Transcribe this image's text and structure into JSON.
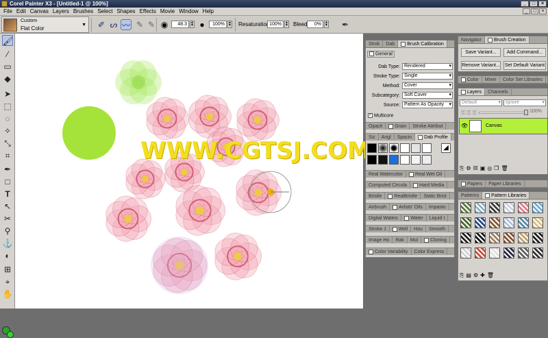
{
  "app": {
    "title": "Corel Painter X3 - [Untitled-1 @ 100%]"
  },
  "window_buttons": [
    "_",
    "□",
    "×"
  ],
  "menu": [
    "File",
    "Edit",
    "Canvas",
    "Layers",
    "Brushes",
    "Select",
    "Shapes",
    "Effects",
    "Movie",
    "Window",
    "Help"
  ],
  "brush_selector": {
    "category": "Custom",
    "variant": "Flat Color"
  },
  "property_bar": {
    "size_value": "48.3",
    "opacity_value": "100%",
    "resaturation_label": "Resaturation:",
    "resaturation_value": "100%",
    "bleed_label": "Bleed:",
    "bleed_value": "0%"
  },
  "watermark": "WWW.CGTSJ.COM",
  "brush_panel": {
    "tabs": [
      "Strok",
      "Dab",
      "Brush Calibration"
    ],
    "general_tab": "General",
    "rows": [
      {
        "label": "Dab Type:",
        "value": "Rendered"
      },
      {
        "label": "Stroke Type:",
        "value": "Single"
      },
      {
        "label": "Method:",
        "value": "Cover"
      },
      {
        "label": "Subcategory:",
        "value": "Soft Cover"
      },
      {
        "label": "Source:",
        "value": "Pattern As Opacity"
      }
    ],
    "multicore": "Multicore",
    "stripes": [
      [
        "Opacit",
        "Grain",
        "Stroke Attribut"
      ],
      [
        "Siz",
        "Angl",
        "Spacin",
        "Dab Profile"
      ],
      [
        "Real Watercolor",
        "Real Wet Oil"
      ],
      [
        "Computed Circula",
        "Hard Media"
      ],
      [
        "Bristle",
        "RealBristle",
        "Static Brist"
      ],
      [
        "Airbrush",
        "Artists' Oils",
        "Impasto"
      ],
      [
        "Digital Waterc",
        "Water",
        "Liquid I"
      ],
      [
        "Stroke J",
        "Well",
        "Hou",
        "Smooth"
      ],
      [
        "Image Ho",
        "Rak",
        "Mul",
        "Cloning"
      ],
      [
        "Color Variability",
        "Color Express"
      ]
    ]
  },
  "navigator_panel": {
    "tabs": [
      "Navigator",
      "Brush Creation"
    ],
    "buttons": [
      "Save Variant...",
      "Add Command...",
      "Remove Variant...",
      "Set Default Variant"
    ]
  },
  "color_panel": {
    "tabs": [
      "Color",
      "Mixer",
      "Color Set Libraries"
    ]
  },
  "layers_panel": {
    "tabs": [
      "Layers",
      "Channels"
    ],
    "composite": "Default",
    "composite2": "Ignore",
    "opacity": "100%",
    "layer_name": "Canvas"
  },
  "papers_panel": {
    "tabs": [
      "Papers",
      "Paper Libraries"
    ]
  },
  "patterns_panel": {
    "tabs": [
      "Patterns",
      "Pattern Libraries"
    ],
    "swatch_colors": [
      "#5a7a3a",
      "#8fb0c8",
      "#3a3a3a",
      "#c8d0e0",
      "#e07a8a",
      "#6ab0d8",
      "#4a6a2a",
      "#2a4a8a",
      "#8a5a3a",
      "#b0c0d8",
      "#5a8aa8",
      "#d8c080",
      "#222222",
      "#1a1a1a",
      "#a08060",
      "#8a5030",
      "#c0a070",
      "#202020",
      "#d0d0d0",
      "#c85040",
      "#e0e0e0",
      "#2a2a4a",
      "#606060",
      "#303030"
    ]
  },
  "colors": {
    "green_circle": "#a6e33a",
    "green_flower": "#a8e860",
    "flower_fill": "#f0a0b0",
    "flower_edge": "#c83a5a",
    "flower_center": "#f2c848",
    "watermark": "#f3dd1f",
    "layer_highlight": "#b4ef3a"
  }
}
